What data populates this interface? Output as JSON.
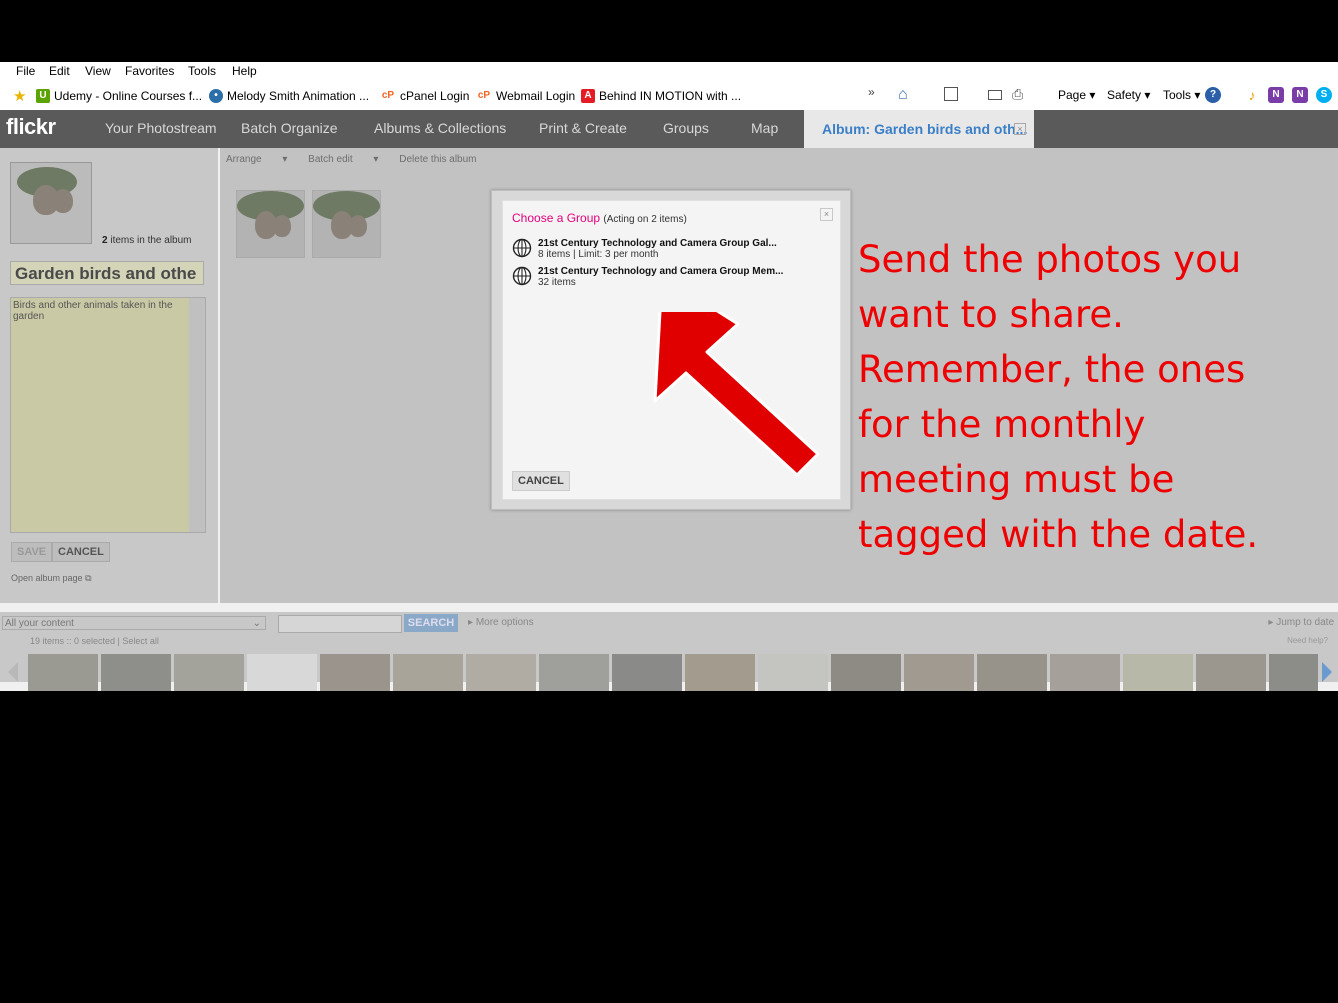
{
  "menu": [
    "File",
    "Edit",
    "View",
    "Favorites",
    "Tools",
    "Help"
  ],
  "favorites": [
    {
      "label": "Udemy - Online Courses f...",
      "icon": "udemy-icon",
      "color": "#5ba300",
      "glyph": "U"
    },
    {
      "label": "Melody Smith Animation ...",
      "icon": "site-icon",
      "color": "#2b6ea8",
      "glyph": "•"
    },
    {
      "label": "cPanel Login",
      "icon": "cpanel-icon",
      "color": "#f26522",
      "glyph": "cP"
    },
    {
      "label": "Webmail Login",
      "icon": "cpanel-icon",
      "color": "#f26522",
      "glyph": "cP"
    },
    {
      "label": "Behind IN MOTION with ...",
      "icon": "adobe-icon",
      "color": "#e51c23",
      "glyph": "A"
    }
  ],
  "ie_toolbar": {
    "page": "Page",
    "safety": "Safety",
    "tools": "Tools"
  },
  "flickr": {
    "logo": "flickr",
    "nav": [
      "Your Photostream",
      "Batch Organize",
      "Albums & Collections",
      "Print & Create",
      "Groups",
      "Map"
    ],
    "active_tab": "Album: Garden birds and oth..."
  },
  "toolbar": {
    "arrange": "Arrange",
    "batch_edit": "Batch edit",
    "delete": "Delete this album"
  },
  "album": {
    "count_num": "2",
    "count_text": " items in the album",
    "title": "Garden birds and othe",
    "description": "Birds and other animals taken in the garden",
    "save": "SAVE",
    "cancel": "CANCEL",
    "open_page": "Open album page"
  },
  "search": {
    "scope": "All your content",
    "button": "SEARCH",
    "more": "More options",
    "jump": "Jump to date",
    "stats": "19 items :: 0 selected | Select all",
    "help": "Need help?"
  },
  "modal": {
    "title": "Choose a Group",
    "subtitle": "(Acting on 2 items)",
    "groups": [
      {
        "name": "21st Century Technology and Camera Group Gal...",
        "meta": "8 items | Limit: 3 per month"
      },
      {
        "name": "21st Century Technology and Camera Group Mem...",
        "meta": "32 items"
      }
    ],
    "cancel": "CANCEL"
  },
  "annotation": {
    "lines": [
      "Send the photos you",
      "want to share.",
      "Remember, the ones",
      "for the monthly",
      "meeting must be",
      "tagged with the date."
    ],
    "color": "#ee0000"
  }
}
